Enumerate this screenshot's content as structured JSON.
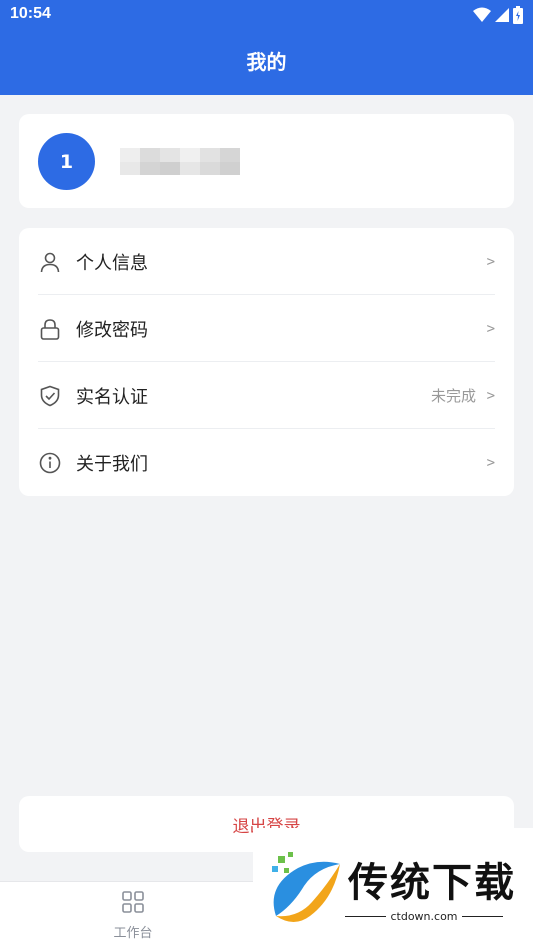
{
  "status": {
    "time": "10:54"
  },
  "header": {
    "title": "我的"
  },
  "profile": {
    "avatar_text": "1"
  },
  "menu": {
    "items": [
      {
        "label": "个人信息",
        "value": "",
        "arrow": ">"
      },
      {
        "label": "修改密码",
        "value": "",
        "arrow": ">"
      },
      {
        "label": "实名认证",
        "value": "未完成",
        "arrow": ">"
      },
      {
        "label": "关于我们",
        "value": "",
        "arrow": ">"
      }
    ]
  },
  "logout": {
    "label": "退出登录"
  },
  "tabbar": {
    "tabs": [
      {
        "label": "工作台",
        "icon": "grid-icon"
      }
    ]
  },
  "watermark": {
    "brand": "传统下载",
    "url": "ctdown.com"
  },
  "colors": {
    "primary": "#2d6be4",
    "danger": "#d64545",
    "background": "#f2f3f5"
  }
}
